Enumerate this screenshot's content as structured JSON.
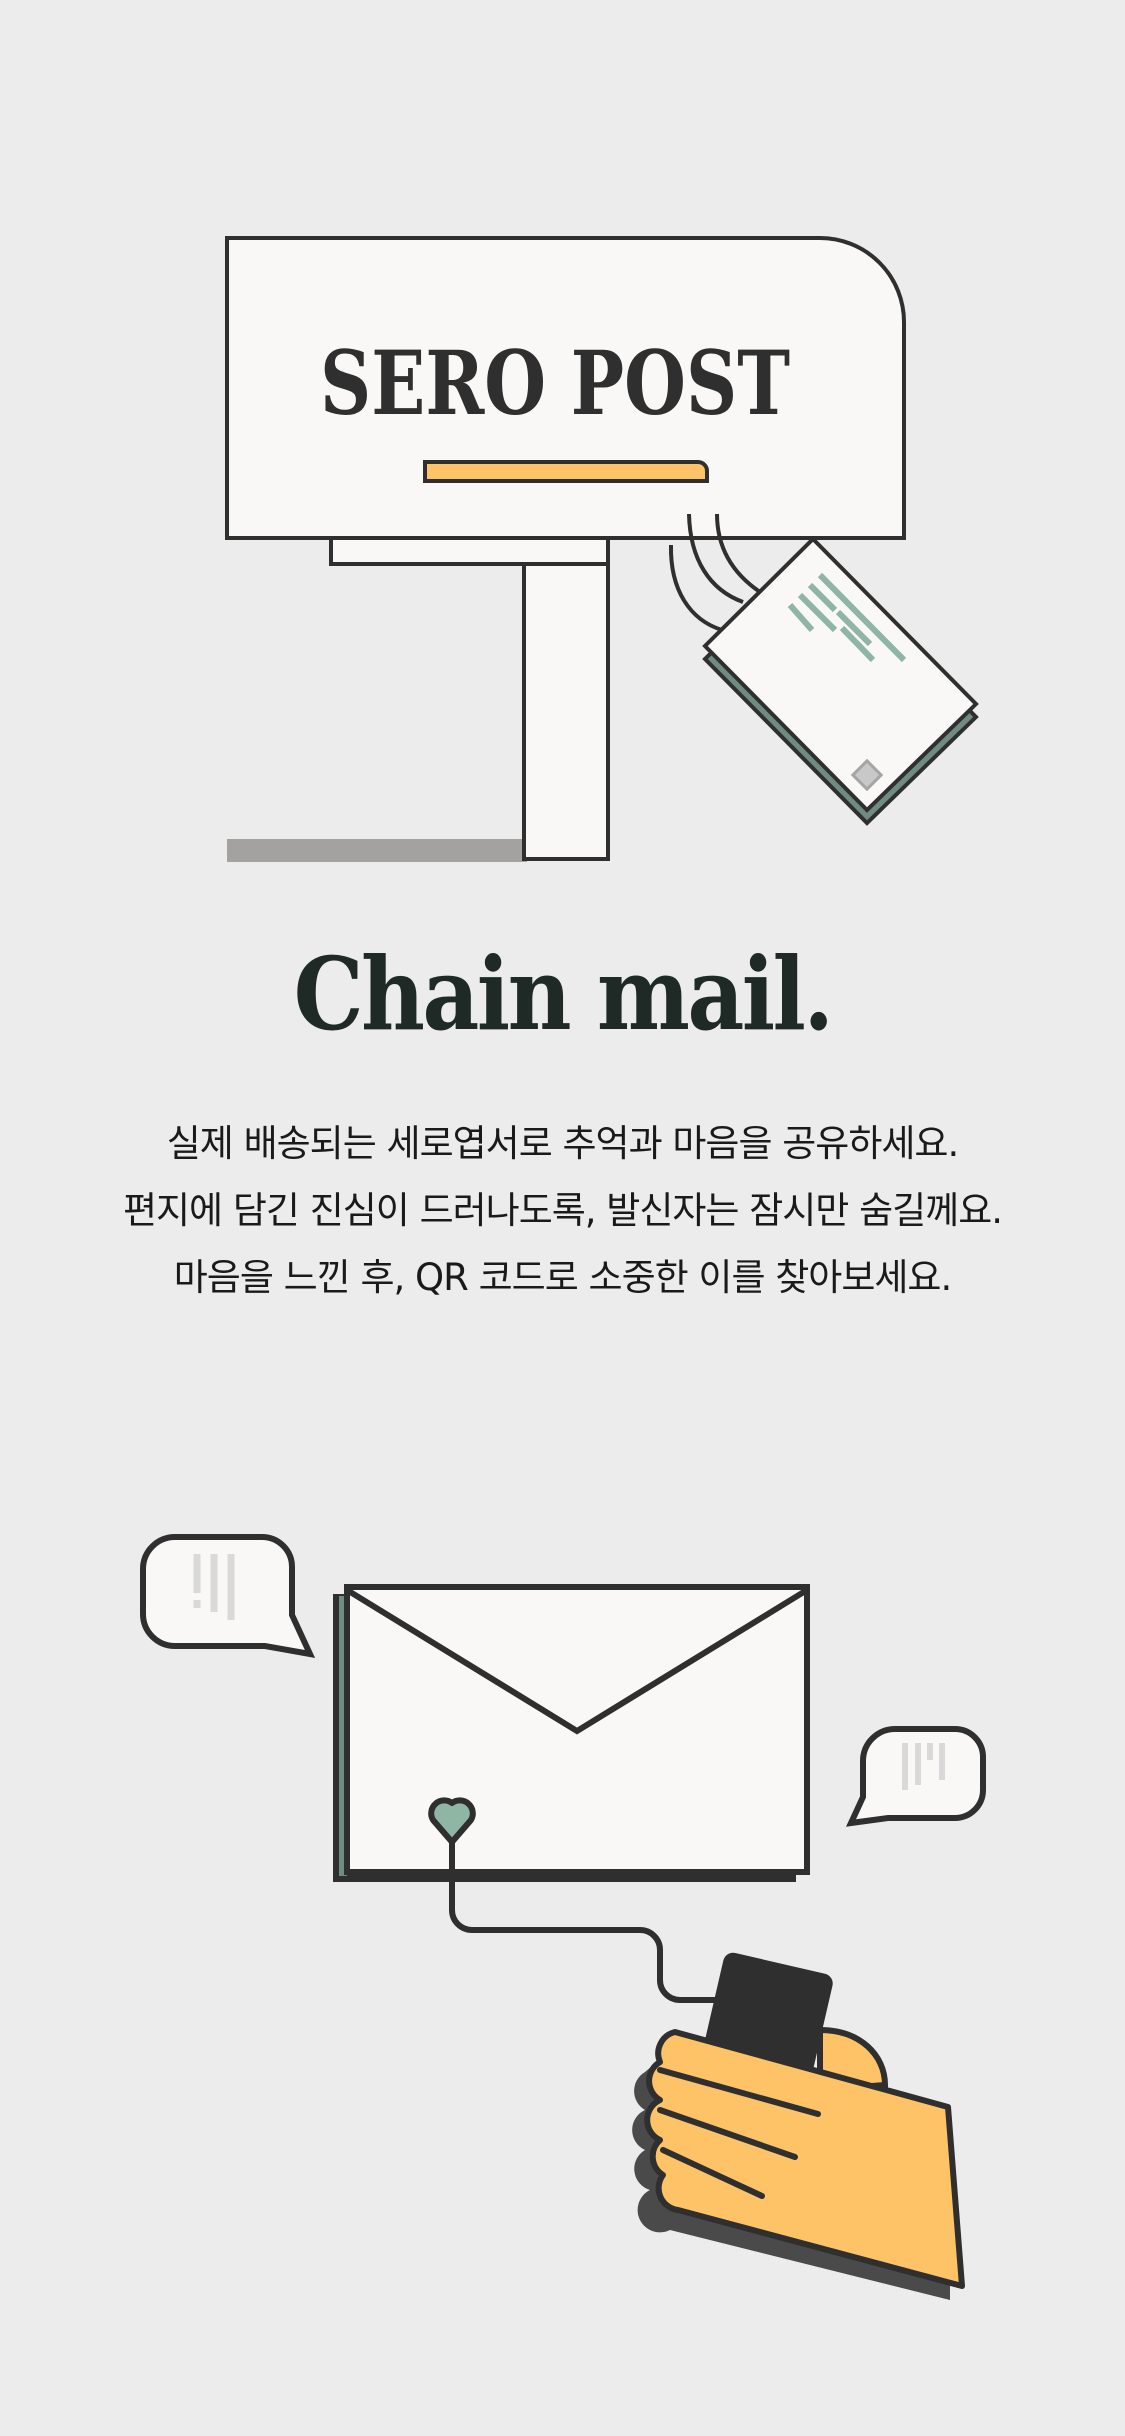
{
  "hero": {
    "logo_text": "SERO POST",
    "title": "Chain mail.",
    "description": [
      "실제 배송되는 세로엽서로 추억과 마음을 공유하세요.",
      "편지에 담긴 진심이 드러나도록, 발신자는 잠시만 숨길께요.",
      "마음을 느낀 후, QR 코드로 소중한 이를 찾아보세요."
    ]
  },
  "colors": {
    "background": "#ececec",
    "ink": "#2f2f2f",
    "accent": "#fec267",
    "sage": "#8fb5a4",
    "paper": "#f9f8f6"
  },
  "icons": [
    "mailbox-illustration",
    "postcard-icon",
    "envelope-icon",
    "heart-icon",
    "speech-bubble-icon",
    "hand-phone-icon"
  ]
}
